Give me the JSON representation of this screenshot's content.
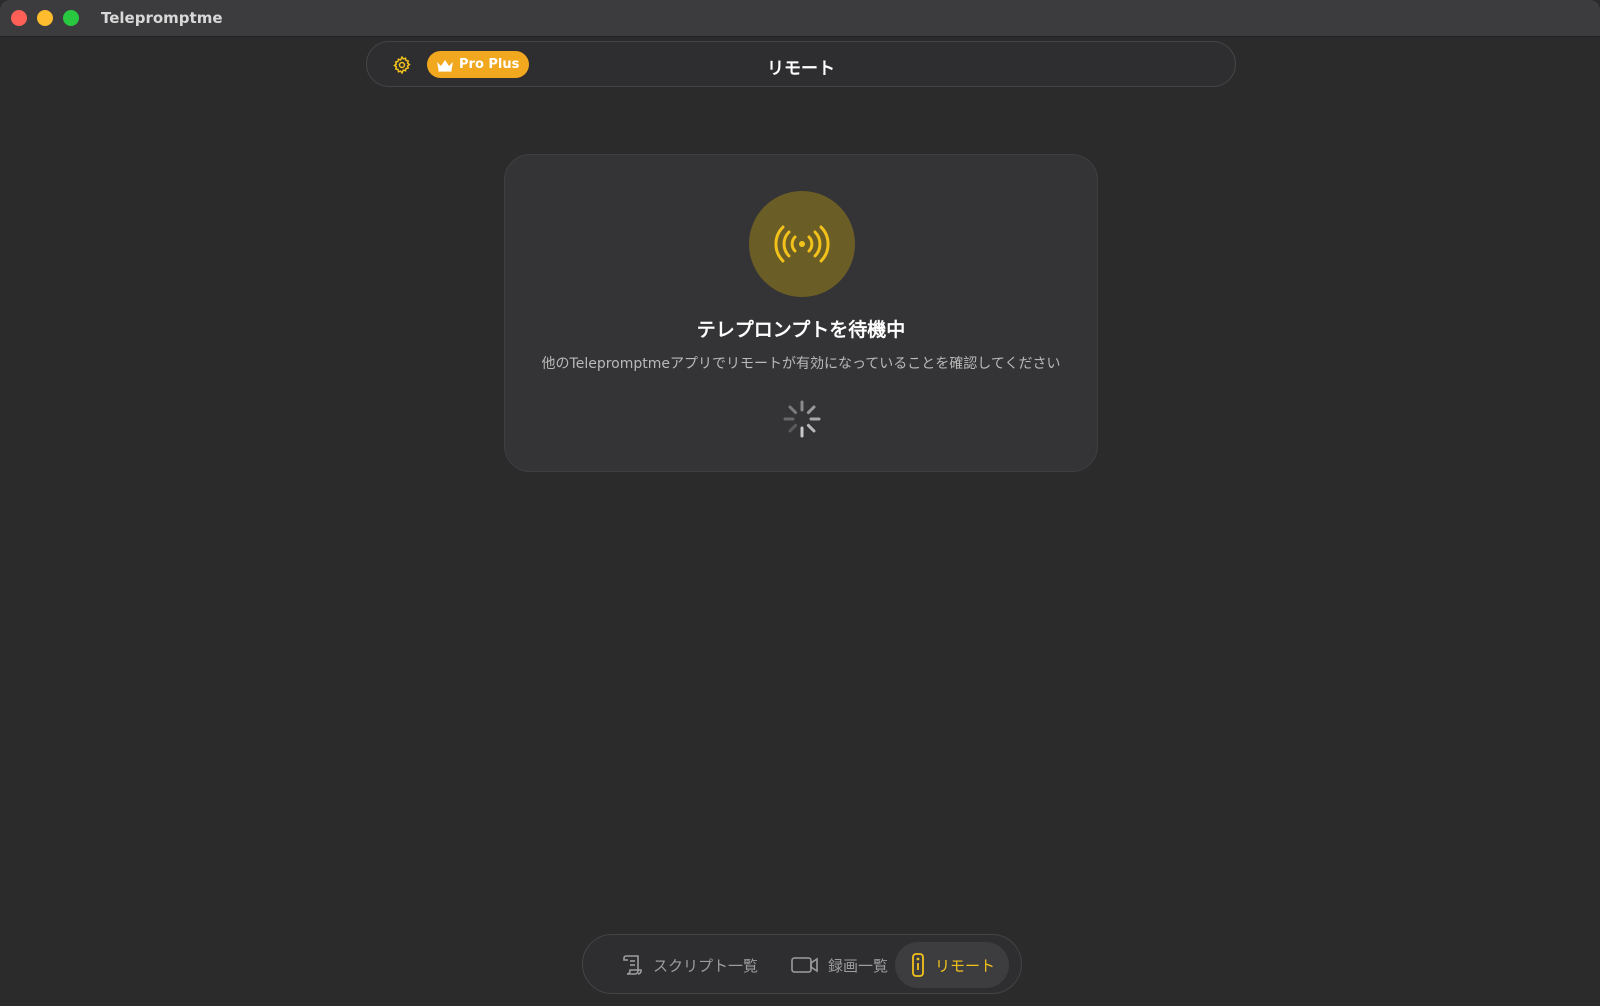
{
  "window": {
    "title": "Telepromptme"
  },
  "topbar": {
    "title": "リモート",
    "badge_label": "Pro Plus"
  },
  "card": {
    "title": "テレプロンプトを待機中",
    "subtitle": "他のTelepromptmeアプリでリモートが有効になっていることを確認してください"
  },
  "nav": {
    "items": [
      {
        "label": "スクリプト一覧",
        "icon": "script-icon",
        "active": false
      },
      {
        "label": "録画一覧",
        "icon": "video-camera-icon",
        "active": false
      },
      {
        "label": "リモート",
        "icon": "remote-icon",
        "active": true
      }
    ]
  },
  "colors": {
    "accent": "#f2c21b",
    "badge": "#f2a81e",
    "background": "#2b2b2c"
  }
}
